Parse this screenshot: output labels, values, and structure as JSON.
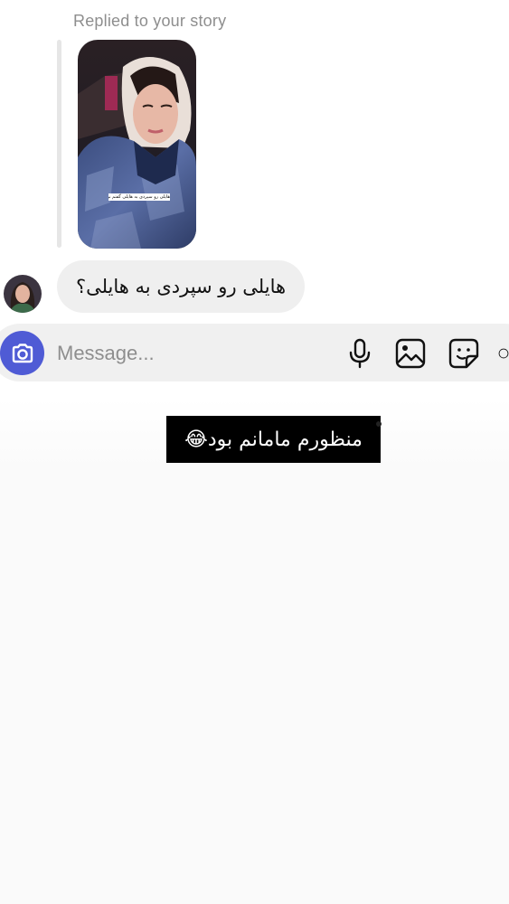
{
  "thread": {
    "reply_note": "Replied to your story",
    "story": {
      "caption": "هایلی رو سپردی به هایلی گفتم نوبت تو هایلی 😂"
    },
    "incoming_message": "هایلی رو سپردی به هایلی؟"
  },
  "composer": {
    "placeholder": "Message...",
    "value": "",
    "icons": [
      "camera-icon",
      "microphone-icon",
      "gallery-icon",
      "sticker-icon",
      "add-icon"
    ]
  },
  "overlay": {
    "caption": "منظورم مامانم بود😂"
  },
  "colors": {
    "camera_button": "#4f5bd5",
    "bubble_bg": "#efefef",
    "composer_bg": "#f0f0f0",
    "meta_text": "#8e8e8e",
    "overlay_bg": "#000000"
  }
}
